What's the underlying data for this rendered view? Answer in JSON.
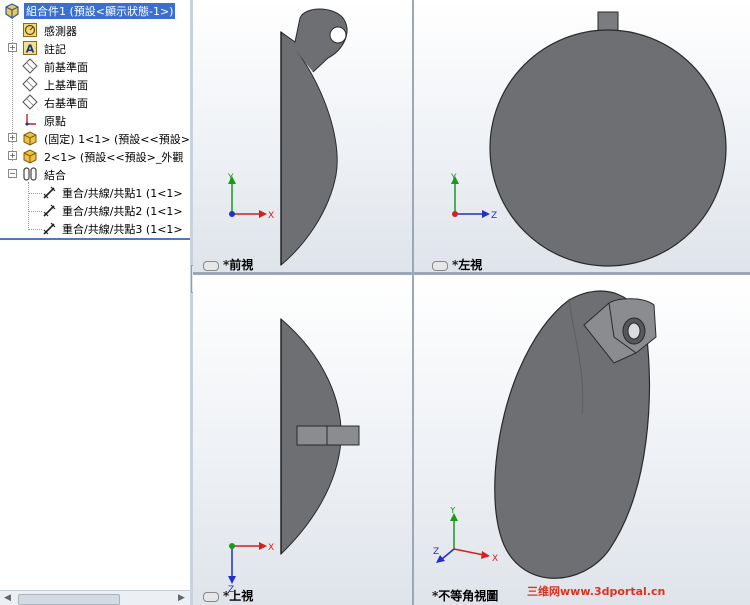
{
  "tree": {
    "items": [
      {
        "label": "組合件1 (預設<顯示狀態-1>)",
        "icon": "assembly-icon"
      },
      {
        "label": "感測器",
        "icon": "sensor-icon"
      },
      {
        "label": "註記",
        "icon": "annotation-icon"
      },
      {
        "label": "前基準面",
        "icon": "plane-icon"
      },
      {
        "label": "上基準面",
        "icon": "plane-icon"
      },
      {
        "label": "右基準面",
        "icon": "plane-icon"
      },
      {
        "label": "原點",
        "icon": "origin-icon"
      },
      {
        "label": "(固定) 1<1> (預設<<預設>",
        "icon": "part-icon"
      },
      {
        "label": "2<1> (預設<<預設>_外觀",
        "icon": "part-icon"
      },
      {
        "label": "結合",
        "icon": "mates-icon"
      },
      {
        "label": "重合/共線/共點1 (1<1>",
        "icon": "mate-icon"
      },
      {
        "label": "重合/共線/共點2 (1<1>",
        "icon": "mate-icon"
      },
      {
        "label": "重合/共線/共點3 (1<1>",
        "icon": "mate-icon"
      }
    ]
  },
  "viewports": {
    "front": {
      "label": "*前視"
    },
    "left": {
      "label": "*左視"
    },
    "top": {
      "label": "*上視"
    },
    "iso": {
      "label": "*不等角視圖"
    }
  },
  "axes": {
    "x": "X",
    "y": "Y",
    "z": "Z"
  },
  "watermark": "三维网www.3dportal.cn",
  "colors": {
    "selection": "#3a6fd0",
    "model": "#6d6f72",
    "axis_x": "#d42020",
    "axis_y": "#1a9a1a",
    "axis_z": "#2030c8"
  }
}
